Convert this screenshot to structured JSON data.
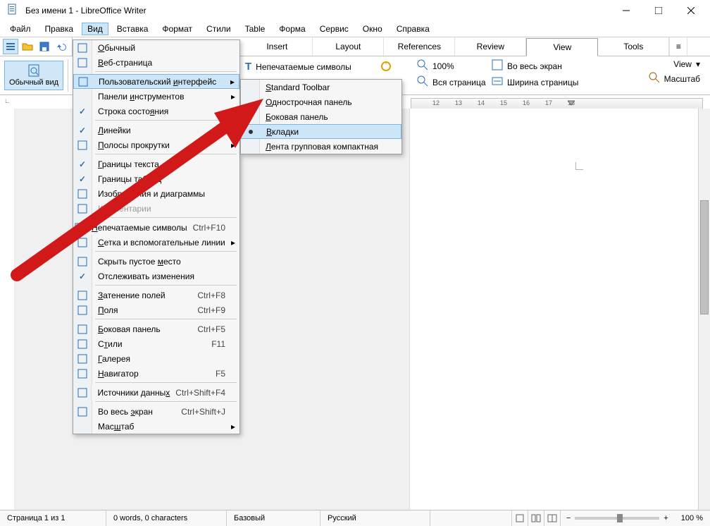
{
  "window": {
    "title": "Без имени 1 - LibreOffice Writer"
  },
  "menubar": [
    "Файл",
    "Правка",
    "Вид",
    "Вставка",
    "Формат",
    "Стили",
    "Table",
    "Форма",
    "Сервис",
    "Окно",
    "Справка"
  ],
  "menubar_active_index": 2,
  "tabs": {
    "items": [
      "Insert",
      "Layout",
      "References",
      "Review",
      "View",
      "Tools"
    ],
    "active_index": 4
  },
  "ribbon": {
    "left_button": "Обычный вид",
    "group2_item": "Непечатаемые символы",
    "zoom100": "100%",
    "whole_page": "Вся страница",
    "fullscreen": "Во весь экран",
    "page_width": "Ширина страницы",
    "right_view": "View",
    "right_scale": "Масштаб"
  },
  "view_menu": {
    "items": [
      {
        "icon": "page-icon",
        "label": "<u>О</u>бычный"
      },
      {
        "icon": "globe-icon",
        "label": "<u>В</u>еб-страница"
      },
      {
        "sep": true
      },
      {
        "icon": "toolbar-icon",
        "label": "Пользовательский <u>и</u>нтерфейс",
        "submenu": true,
        "highlight": true
      },
      {
        "icon": "",
        "label": "Панели <u>и</u>нструментов",
        "submenu": true
      },
      {
        "icon": "",
        "label": "Строка состо<u>я</u>ния",
        "checked": true
      },
      {
        "sep": true
      },
      {
        "icon": "ruler-icon",
        "label": "<u>Л</u>инейки",
        "submenu": true,
        "checked": true
      },
      {
        "icon": "scroll-icon",
        "label": "<u>П</u>олосы прокрутки",
        "submenu": true
      },
      {
        "sep": true
      },
      {
        "icon": "",
        "label": "<u>Г</u>раницы текста",
        "checked": true
      },
      {
        "icon": "",
        "label": "Границы т<u>а</u>блиц",
        "checked": true
      },
      {
        "icon": "image-icon",
        "label": "Изобра<u>ж</u>ения и диаграммы"
      },
      {
        "icon": "comment-icon",
        "label": "<u>К</u>омментарии",
        "disabled": true
      },
      {
        "sep": true
      },
      {
        "icon": "pilcrow-icon",
        "label": "<u>Н</u>епечатаемые символы",
        "shortcut": "Ctrl+F10"
      },
      {
        "icon": "grid-icon",
        "label": "<u>С</u>етка и вспомогательные линии",
        "submenu": true
      },
      {
        "sep": true
      },
      {
        "icon": "hide-icon",
        "label": "Скрыть пустое <u>м</u>есто"
      },
      {
        "icon": "",
        "label": "Отслеживать изменения",
        "checked": true
      },
      {
        "sep": true
      },
      {
        "icon": "shade-icon",
        "label": "<u>З</u>атенение полей",
        "shortcut": "Ctrl+F8"
      },
      {
        "icon": "field-icon",
        "label": "<u>П</u>оля",
        "shortcut": "Ctrl+F9"
      },
      {
        "sep": true
      },
      {
        "icon": "sidebar-icon",
        "label": "<u>Б</u>оковая панель",
        "shortcut": "Ctrl+F5"
      },
      {
        "icon": "styles-icon",
        "label": "С<u>т</u>или",
        "shortcut": "F11"
      },
      {
        "icon": "gallery-icon",
        "label": "<u>Г</u>алерея"
      },
      {
        "icon": "compass-icon",
        "label": "<u>Н</u>авигатор",
        "shortcut": "F5"
      },
      {
        "sep": true
      },
      {
        "icon": "datasource-icon",
        "label": "Источники данны<u>х</u>",
        "shortcut": "Ctrl+Shift+F4"
      },
      {
        "sep": true
      },
      {
        "icon": "fullscreen-icon",
        "label": "Во весь <u>э</u>кран",
        "shortcut": "Ctrl+Shift+J"
      },
      {
        "icon": "",
        "label": "Мас<u>ш</u>таб",
        "submenu": true
      }
    ]
  },
  "ui_submenu": {
    "items": [
      {
        "label": "<u>S</u>tandard Toolbar"
      },
      {
        "label": "<u>О</u>днострочная панель"
      },
      {
        "label": "<u>Б</u>оковая панель"
      },
      {
        "label": "<u>В</u>кладки",
        "selected": true
      },
      {
        "label": "<u>Л</u>ента групповая компактная"
      }
    ]
  },
  "ruler_ticks": [
    "12",
    "13",
    "14",
    "15",
    "16",
    "17",
    "18"
  ],
  "statusbar": {
    "page": "Страница 1 из 1",
    "words": "0 words, 0 characters",
    "style": "Базовый",
    "lang": "Русский",
    "zoom": "100 %"
  }
}
